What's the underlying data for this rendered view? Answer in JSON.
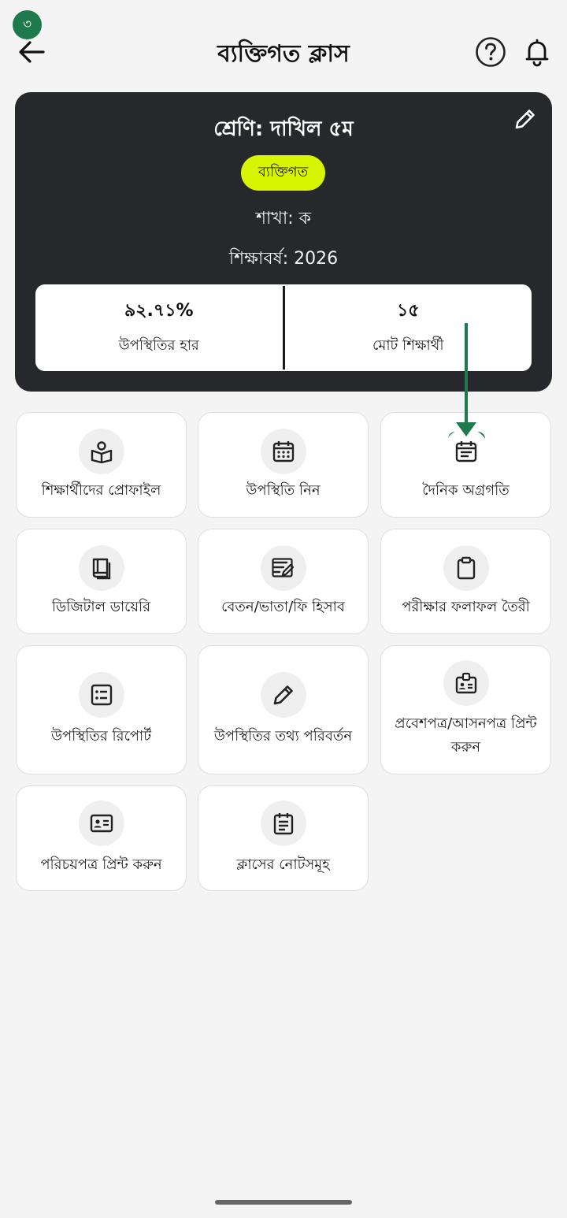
{
  "step_badge": "৩",
  "header": {
    "title": "ব্যক্তিগত ক্লাস"
  },
  "class_card": {
    "class_name": "শ্রেণি: দাখিল ৫ম",
    "type_chip": "ব্যক্তিগত",
    "section": "শাখা: ক",
    "academic_year": "শিক্ষাবর্ষ: 2026",
    "stats": [
      {
        "value": "৯২.৭১%",
        "label": "উপস্থিতির হার"
      },
      {
        "value": "১৫",
        "label": "মোট শিক্ষার্থী"
      }
    ]
  },
  "tiles": [
    {
      "label": "শিক্ষার্থীদের প্রোফাইল",
      "icon": "reader-icon"
    },
    {
      "label": "উপস্থিতি নিন",
      "icon": "calendar-icon"
    },
    {
      "label": "দৈনিক অগ্রগতি",
      "icon": "calendar-notes-icon"
    },
    {
      "label": "ডিজিটাল ডায়েরি",
      "icon": "book-icon"
    },
    {
      "label": "বেতন/ভাতা/ফি হিসাব",
      "icon": "edit-note-icon"
    },
    {
      "label": "পরীক্ষার ফলাফল তৈরী",
      "icon": "clipboard-icon"
    },
    {
      "label": "উপস্থিতির রিপোর্ট",
      "icon": "list-icon"
    },
    {
      "label": "উপস্থিতির তথ্য পরিবর্তন",
      "icon": "pencil-icon"
    },
    {
      "label": "প্রবেশপত্র/আসনপত্র প্রিন্ট করুন",
      "icon": "id-badge-icon"
    },
    {
      "label": "পরিচয়পত্র প্রিন্ট করুন",
      "icon": "id-card-icon"
    },
    {
      "label": "ক্লাসের নোটসমূহ",
      "icon": "notes-icon"
    }
  ],
  "colors": {
    "accent_green": "#1e7a4c",
    "chip_yellow": "#d8f500",
    "card_dark": "#27282b"
  }
}
